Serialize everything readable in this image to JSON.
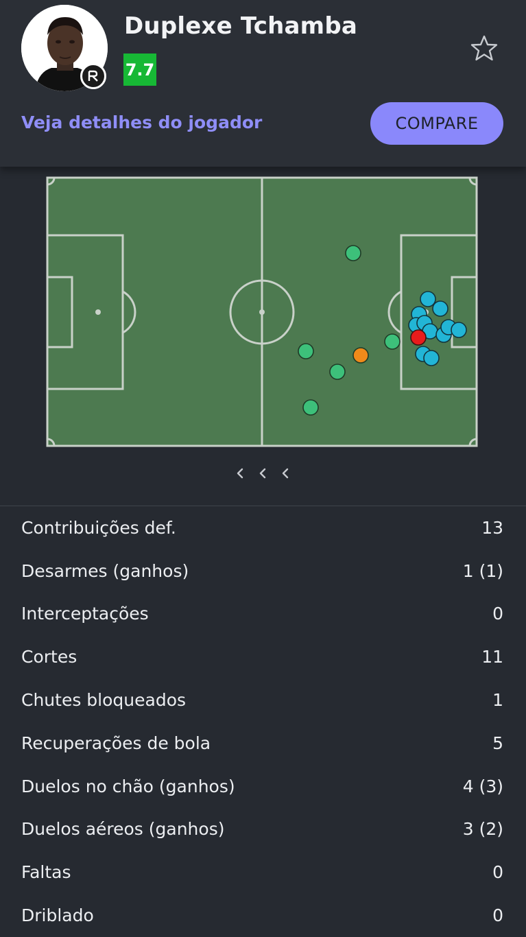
{
  "player": {
    "name": "Duplexe Tchamba",
    "rating": "7.7",
    "rating_color": "#17b835",
    "avatar_icon": "player-photo",
    "team_badge_icon": "remo-crest-icon"
  },
  "actions": {
    "details_link": "Veja detalhes do jogador",
    "compare_button": "COMPARE",
    "favorite_icon": "star-icon"
  },
  "pitch_map": {
    "pitch_color": "#4d7a50",
    "line_color": "#c9d1c9",
    "legend_colors": {
      "green": "#3dc07a",
      "blue": "#22b5d6",
      "orange": "#f08a1a",
      "red": "#e81c1c"
    }
  },
  "pager": {
    "icon": "chevron-left-icon"
  },
  "stats": [
    {
      "label": "Contribuições def.",
      "value": "13"
    },
    {
      "label": "Desarmes (ganhos)",
      "value": "1 (1)"
    },
    {
      "label": "Interceptações",
      "value": "0"
    },
    {
      "label": "Cortes",
      "value": "11"
    },
    {
      "label": "Chutes bloqueados",
      "value": "1"
    },
    {
      "label": "Recuperações de bola",
      "value": "5"
    },
    {
      "label": "Duelos no chão (ganhos)",
      "value": "4 (3)"
    },
    {
      "label": "Duelos aéreos (ganhos)",
      "value": "3 (2)"
    },
    {
      "label": "Faltas",
      "value": "0"
    },
    {
      "label": "Driblado",
      "value": "0"
    }
  ]
}
